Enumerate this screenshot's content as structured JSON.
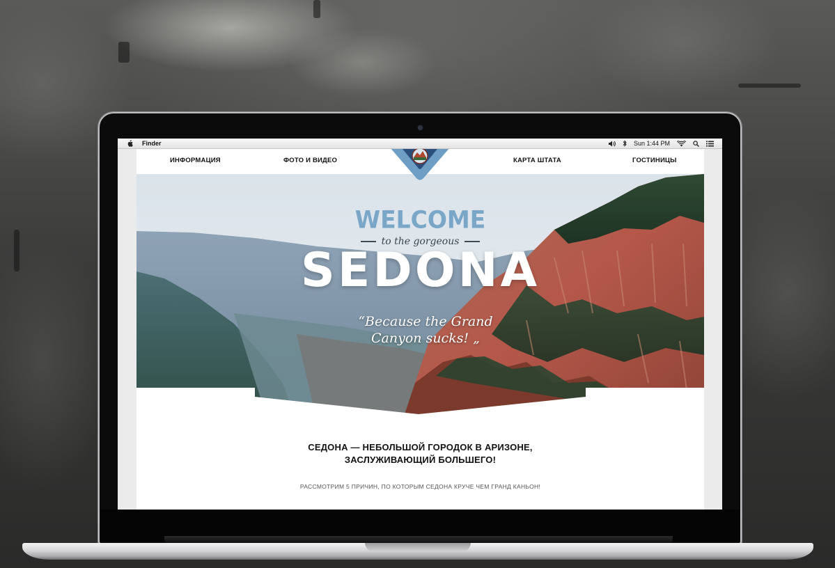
{
  "menubar": {
    "app_name": "Finder",
    "clock": "Sun 1:44 PM",
    "icons": [
      "apple-icon",
      "volume-icon",
      "bluetooth-icon",
      "wifi-icon",
      "spotlight-search-icon",
      "notification-list-icon"
    ]
  },
  "site": {
    "nav": {
      "items": [
        {
          "label": "ИНФОРМАЦИЯ"
        },
        {
          "label": "ФОТО И ВИДЕО"
        },
        {
          "label": "КАРТА ШТАТА"
        },
        {
          "label": "ГОСТИНИЦЫ"
        }
      ],
      "logo": "CITY OF SEDONA"
    },
    "hero": {
      "welcome": "WELCOME",
      "tagline": "to the gorgeous",
      "title": "SEDONA",
      "quote_line1": "“Because the Grand",
      "quote_line2": "Canyon sucks! „"
    },
    "content": {
      "headline_line1": "СЕДОНА — НЕБОЛЬШОЙ ГОРОДОК В АРИЗОНЕ,",
      "headline_line2": "ЗАСЛУЖИВАЮЩИЙ БОЛЬШЕГО!",
      "subline": "РАССМОТРИМ 5 ПРИЧИН, ПО КОТОРЫМ СЕДОНА КРУЧЕ ЧЕМ ГРАНД КАНЬОН!"
    },
    "colors": {
      "accent_blue": "#7aa7c8",
      "nav_text": "#111111",
      "hero_text": "#ffffff"
    }
  }
}
